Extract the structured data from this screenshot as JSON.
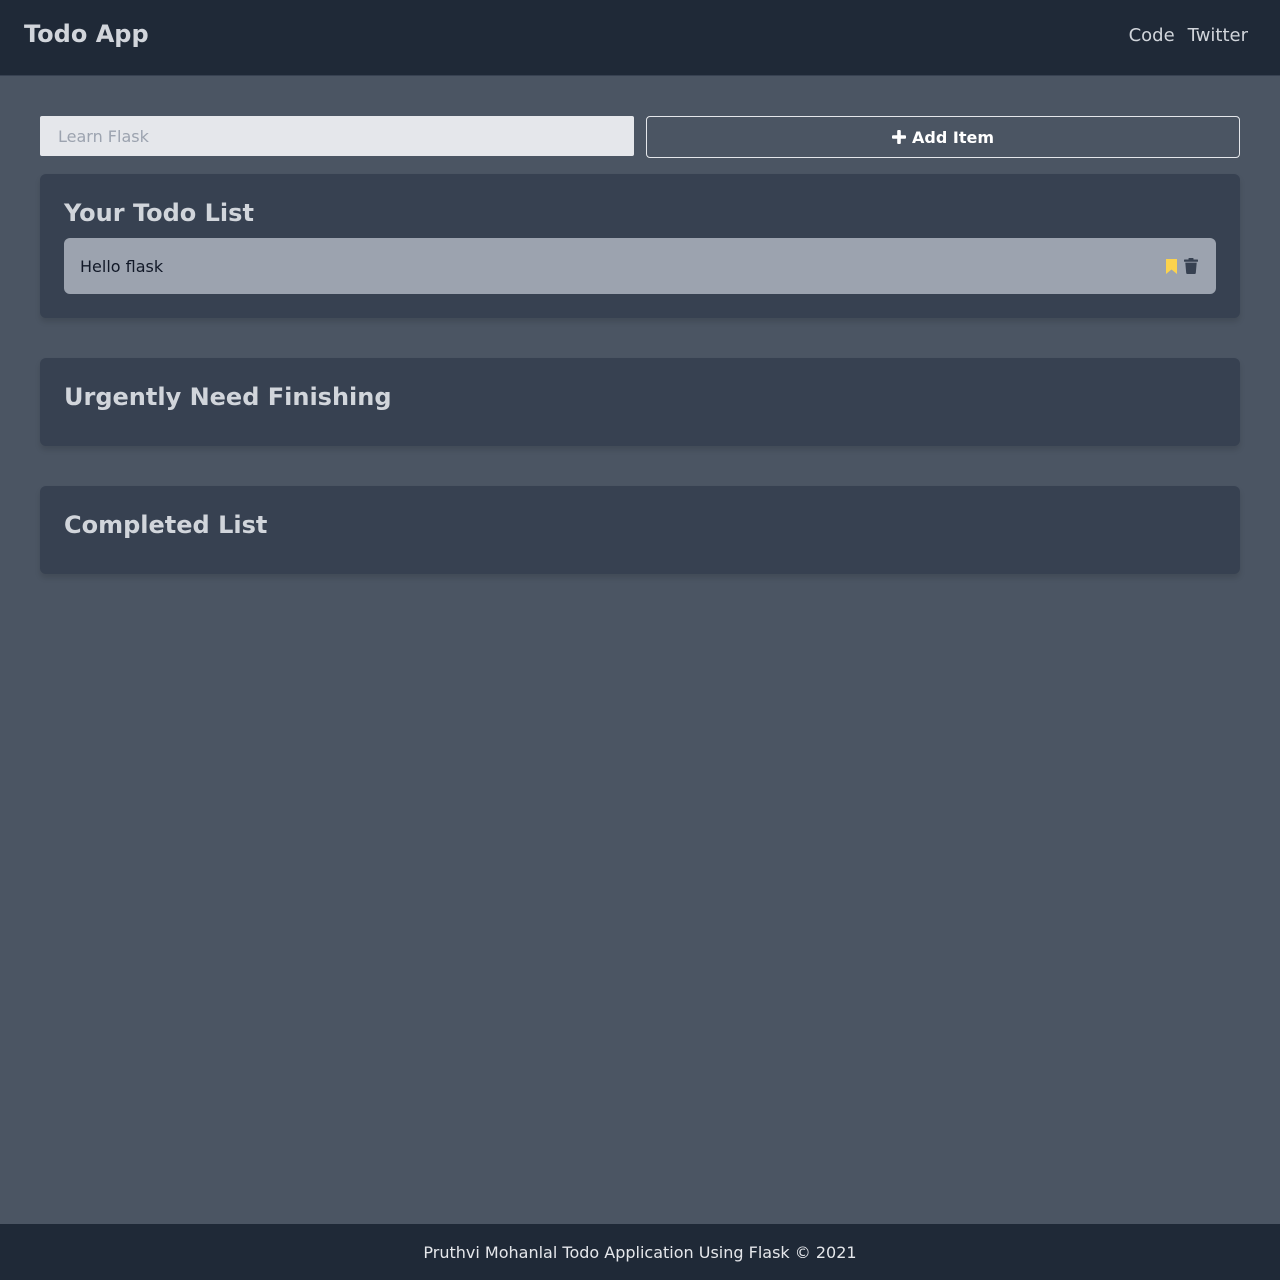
{
  "navbar": {
    "brand": "Todo App",
    "links": [
      "Code",
      "Twitter"
    ]
  },
  "add_form": {
    "input_placeholder": "Learn Flask",
    "input_value": "",
    "button_label": "Add Item",
    "button_icon": "plus-icon"
  },
  "lists": {
    "todo": {
      "title": "Your Todo List",
      "items": [
        {
          "text": "Hello flask",
          "actions": [
            "bookmark-icon",
            "trash-icon"
          ]
        }
      ]
    },
    "urgent": {
      "title": "Urgently Need Finishing",
      "items": []
    },
    "completed": {
      "title": "Completed List",
      "items": []
    }
  },
  "footer": {
    "text": "Pruthvi Mohanlal Todo Application Using Flask © 2021"
  },
  "colors": {
    "background": "#4b5563",
    "navbar": "#1f2937",
    "card": "#374151",
    "item": "#9ca3af",
    "bookmark": "#fcd34d",
    "trash": "#374151"
  }
}
